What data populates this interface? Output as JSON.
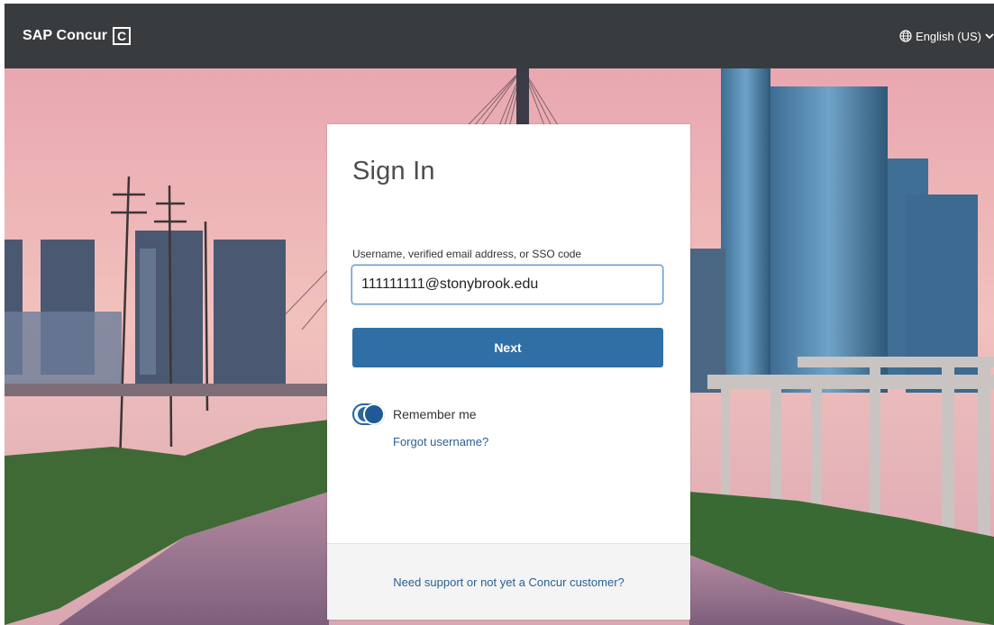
{
  "header": {
    "brand_name": "SAP Concur",
    "brand_mark": "C",
    "language_label": "English (US)",
    "language_icon": "globe-icon",
    "language_chevron_icon": "chevron-down-icon"
  },
  "sign_in": {
    "title": "Sign In",
    "username_label": "Username, verified email address, or SSO code",
    "username_value": "111111111@stonybrook.edu",
    "next_label": "Next",
    "remember_me_label": "Remember me",
    "remember_me_on": true,
    "forgot_username_label": "Forgot username?",
    "support_label": "Need support or not yet a Concur customer?"
  },
  "colors": {
    "header_bg": "#393c3f",
    "accent": "#2f6fa6",
    "link": "#2a5f94"
  }
}
